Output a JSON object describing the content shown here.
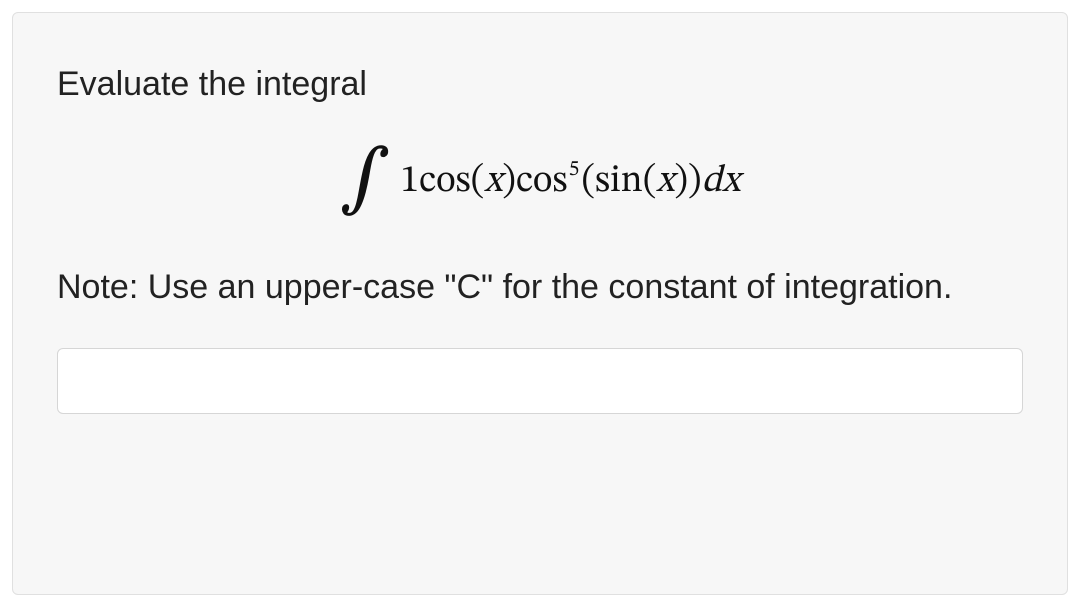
{
  "prompt": "Evaluate the integral",
  "math": {
    "integral_sign": "∫",
    "coef": "1",
    "fn1": "cos",
    "lp": "(",
    "x": "x",
    "rp": ")",
    "sp": " ",
    "fn2": "cos",
    "exp5": "5",
    "fn3": "sin",
    "diff_d": "d",
    "diff_x": "x"
  },
  "note": "Note: Use an upper-case \"C\" for the constant of integration.",
  "answer_value": ""
}
